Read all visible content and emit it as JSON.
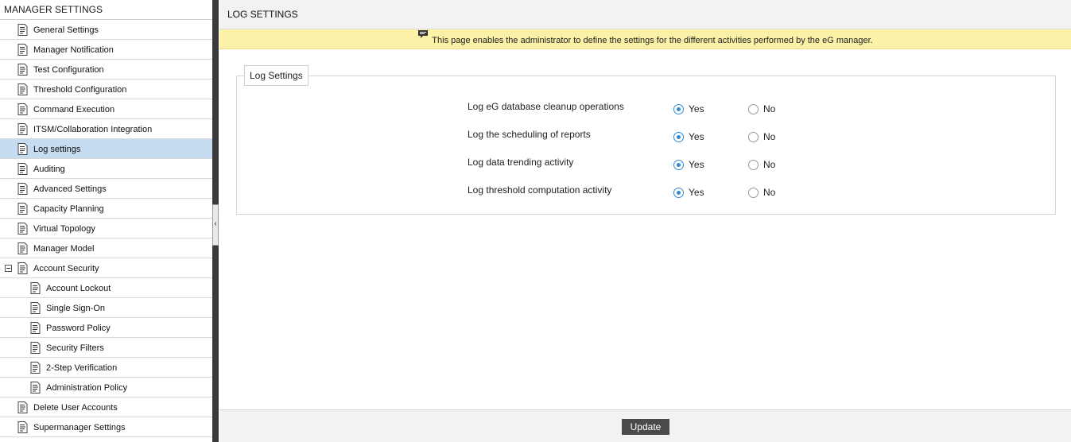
{
  "sidebar": {
    "title": "MANAGER SETTINGS",
    "items": [
      {
        "label": "General Settings",
        "level": 0
      },
      {
        "label": "Manager Notification",
        "level": 0
      },
      {
        "label": "Test Configuration",
        "level": 0
      },
      {
        "label": "Threshold Configuration",
        "level": 0
      },
      {
        "label": "Command Execution",
        "level": 0
      },
      {
        "label": "ITSM/Collaboration Integration",
        "level": 0
      },
      {
        "label": "Log settings",
        "level": 0,
        "active": true
      },
      {
        "label": "Auditing",
        "level": 0
      },
      {
        "label": "Advanced Settings",
        "level": 0
      },
      {
        "label": "Capacity Planning",
        "level": 0
      },
      {
        "label": "Virtual Topology",
        "level": 0
      },
      {
        "label": "Manager Model",
        "level": 0
      },
      {
        "label": "Account Security",
        "level": 0,
        "expanded": true
      },
      {
        "label": "Account Lockout",
        "level": 1
      },
      {
        "label": "Single Sign-On",
        "level": 1
      },
      {
        "label": "Password Policy",
        "level": 1
      },
      {
        "label": "Security Filters",
        "level": 1
      },
      {
        "label": "2-Step Verification",
        "level": 1
      },
      {
        "label": "Administration Policy",
        "level": 1
      },
      {
        "label": "Delete User Accounts",
        "level": 0
      },
      {
        "label": "Supermanager Settings",
        "level": 0
      }
    ]
  },
  "main": {
    "title": "LOG SETTINGS",
    "info": "This page enables the administrator to define the settings for the different activities performed by the eG manager.",
    "section_legend": "Log Settings",
    "options": [
      {
        "question": "Log eG database cleanup operations",
        "yes_label": "Yes",
        "no_label": "No",
        "selected": "Yes"
      },
      {
        "question": "Log the scheduling of reports",
        "yes_label": "Yes",
        "no_label": "No",
        "selected": "Yes"
      },
      {
        "question": "Log data trending activity",
        "yes_label": "Yes",
        "no_label": "No",
        "selected": "Yes"
      },
      {
        "question": "Log threshold computation activity",
        "yes_label": "Yes",
        "no_label": "No",
        "selected": "Yes"
      }
    ],
    "update_label": "Update"
  },
  "colors": {
    "accent": "#2e8ad6",
    "active_item_bg": "#c6dcf0",
    "info_bar_bg": "#fbf1a7",
    "splitter": "#3a3a3a",
    "button_bg": "#4a4a4a"
  },
  "icons": {
    "nav_item": "document-list-icon",
    "collapse": "minus-box-icon",
    "info": "speech-bubble-icon",
    "splitter": "chevron-left-icon"
  }
}
